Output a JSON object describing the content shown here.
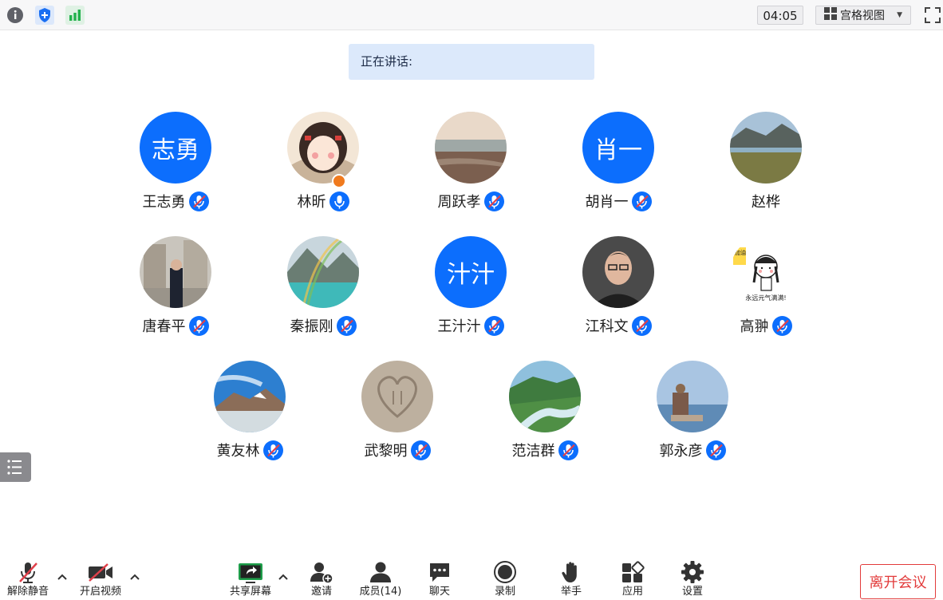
{
  "topbar": {
    "icons": [
      "info-icon",
      "security-shield-icon",
      "signal-strength-icon"
    ],
    "timer": "04:05",
    "view_label": "宫格视图",
    "fullscreen_icon": "fullscreen-icon"
  },
  "speaking": {
    "label": "正在讲话:"
  },
  "participants": [
    {
      "name": "王志勇",
      "initials": "志勇",
      "mic": "muted"
    },
    {
      "name": "林昕",
      "mic": "on",
      "host": true
    },
    {
      "name": "周跃孝",
      "mic": "muted"
    },
    {
      "name": "胡肖一",
      "initials": "肖一",
      "mic": "muted"
    },
    {
      "name": "赵桦",
      "mic": "none"
    },
    {
      "name": "唐春平",
      "mic": "muted"
    },
    {
      "name": "秦振刚",
      "mic": "muted"
    },
    {
      "name": "王汁汁",
      "initials": "汁汁",
      "mic": "muted"
    },
    {
      "name": "江科文",
      "mic": "muted"
    },
    {
      "name": "高翀",
      "mic": "muted"
    },
    {
      "name": "黄友林",
      "mic": "muted"
    },
    {
      "name": "武黎明",
      "mic": "muted"
    },
    {
      "name": "范洁群",
      "mic": "muted"
    },
    {
      "name": "郭永彦",
      "mic": "muted"
    }
  ],
  "avatar_image_text": {
    "cheer": "加油",
    "motto": "永远元气满满!"
  },
  "toolbar": {
    "unmute": "解除静音",
    "start_video": "开启视频",
    "share_screen": "共享屏幕",
    "invite": "邀请",
    "members": "成员(14)",
    "chat": "聊天",
    "record": "录制",
    "raise_hand": "举手",
    "apps": "应用",
    "settings": "设置",
    "leave": "离开会议"
  },
  "colors": {
    "accent": "#0c6efd",
    "leave": "#e23b3b",
    "muted_slash": "#e0404a",
    "host_badge": "#f07a1e"
  }
}
